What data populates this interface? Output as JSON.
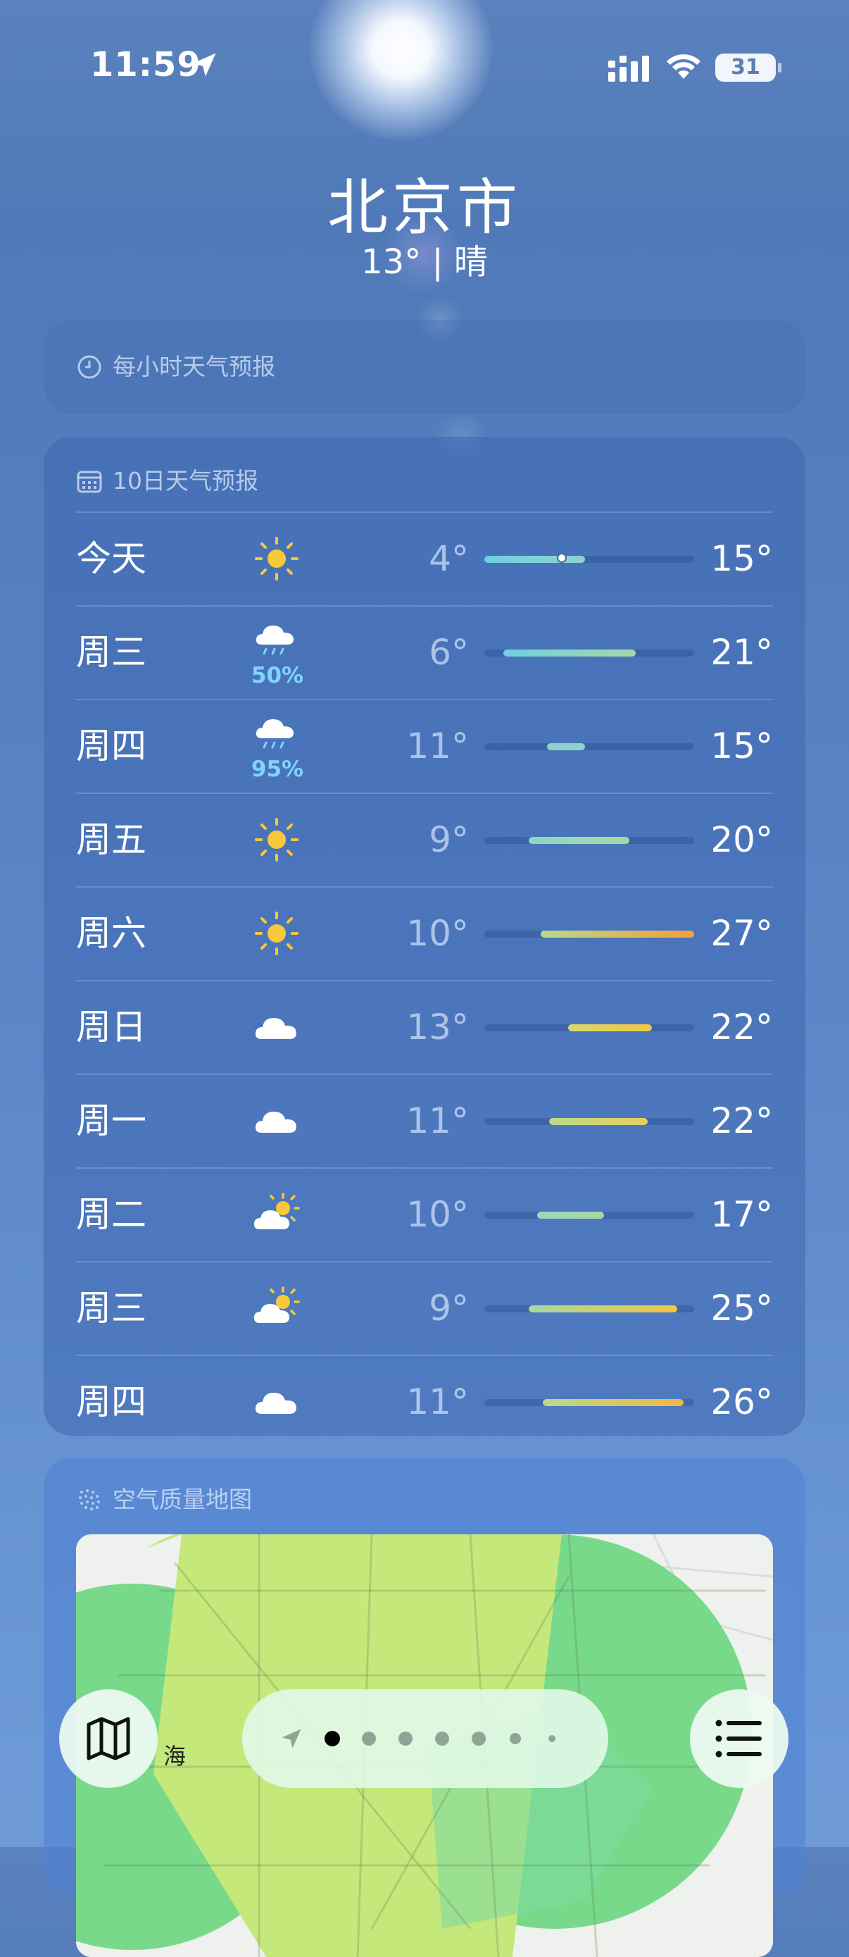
{
  "status_bar": {
    "time": "11:59",
    "battery": "31"
  },
  "header": {
    "city": "北京市",
    "current": "13° | 晴"
  },
  "hourly_card": {
    "title": "每小时天气预报"
  },
  "daily_card": {
    "title": "10日天气预报",
    "rows": [
      {
        "day": "今天",
        "icon": "sun-icon",
        "precip": "",
        "low": "4°",
        "high": "15°",
        "bar_start": 0.0,
        "bar_end": 0.48,
        "colors": [
          "#6fd0e0",
          "#8fd3d0"
        ],
        "current_marker": 0.37
      },
      {
        "day": "周三",
        "icon": "cloud-rain-icon",
        "precip": "50%",
        "low": "6°",
        "high": "21°",
        "bar_start": 0.09,
        "bar_end": 0.72,
        "colors": [
          "#6fd0e0",
          "#a6d7a8"
        ]
      },
      {
        "day": "周四",
        "icon": "cloud-rain-icon",
        "precip": "95%",
        "low": "11°",
        "high": "15°",
        "bar_start": 0.3,
        "bar_end": 0.48,
        "colors": [
          "#8fd3c8",
          "#8fd3c8"
        ]
      },
      {
        "day": "周五",
        "icon": "sun-icon",
        "precip": "",
        "low": "9°",
        "high": "20°",
        "bar_start": 0.21,
        "bar_end": 0.69,
        "colors": [
          "#8fd6c4",
          "#a8d8a0"
        ]
      },
      {
        "day": "周六",
        "icon": "sun-icon",
        "precip": "",
        "low": "10°",
        "high": "27°",
        "bar_start": 0.27,
        "bar_end": 1.0,
        "colors": [
          "#b9d98c",
          "#f2a03a"
        ]
      },
      {
        "day": "周日",
        "icon": "cloud-icon",
        "precip": "",
        "low": "13°",
        "high": "22°",
        "bar_start": 0.4,
        "bar_end": 0.8,
        "colors": [
          "#d8d770",
          "#f2c640"
        ]
      },
      {
        "day": "周一",
        "icon": "cloud-icon",
        "precip": "",
        "low": "11°",
        "high": "22°",
        "bar_start": 0.31,
        "bar_end": 0.78,
        "colors": [
          "#b9d98c",
          "#e8d060"
        ]
      },
      {
        "day": "周二",
        "icon": "cloud-sun-icon",
        "precip": "",
        "low": "10°",
        "high": "17°",
        "bar_start": 0.25,
        "bar_end": 0.57,
        "colors": [
          "#9fd6c0",
          "#a8d8a0"
        ]
      },
      {
        "day": "周三",
        "icon": "cloud-sun-icon",
        "precip": "",
        "low": "9°",
        "high": "25°",
        "bar_start": 0.21,
        "bar_end": 0.92,
        "colors": [
          "#a8d8a0",
          "#f2c640"
        ]
      },
      {
        "day": "周四",
        "icon": "cloud-icon",
        "precip": "",
        "low": "11°",
        "high": "26°",
        "bar_start": 0.28,
        "bar_end": 0.95,
        "colors": [
          "#b9d98c",
          "#f2b840"
        ]
      }
    ]
  },
  "air_quality_card": {
    "title": "空气质量地图",
    "map_label": "海"
  },
  "bottom_bar": {
    "map_button_icon": "map-icon",
    "list_button_icon": "list-icon",
    "page_count": 7,
    "active_page": 0
  },
  "colors": {
    "background_top": "#5b82bd",
    "background_bottom": "#6f9cd9",
    "precip_text": "#7fd3ff"
  }
}
